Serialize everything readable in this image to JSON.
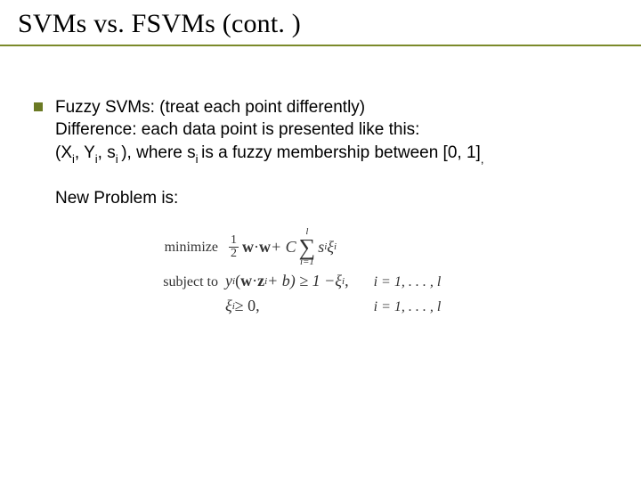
{
  "title": "SVMs vs. FSVMs (cont. )",
  "bullet": {
    "line1": "Fuzzy SVMs: (treat each point differently)",
    "line2": "Difference: each data point is presented like this:",
    "line3_pre": "(X",
    "line3_i1": "i",
    "line3_mid1": ", Y",
    "line3_i2": "i",
    "line3_mid2": ", s",
    "line3_i3": "i ",
    "line3_mid3": "), where s",
    "line3_i4": "i ",
    "line3_post": "is a fuzzy membership between [0, 1]",
    "line3_comma": ","
  },
  "new_problem": "New Problem is:",
  "formula": {
    "minimize": "minimize",
    "half_num": "1",
    "half_den": "2",
    "w": "w",
    "dot": " · ",
    "plusC": " + C",
    "sum_top": "l",
    "sum_sigma": "∑",
    "sum_bot": "i=1",
    "s": "s",
    "s_i": "i",
    "xi": "ξ",
    "xi_i": "i",
    "subject": "subject to",
    "y": "y",
    "y_i": "i",
    "open": "(",
    "z": "z",
    "z_i": "i",
    "plus_b": " + b) ≥ 1 − ",
    "idx1": "i = 1, . . . , l",
    "row3_lhs_xi": "ξ",
    "row3_lhs_i": "i",
    "row3_geq": " ≥ 0,",
    "idx2": "i = 1, . . . , l"
  }
}
